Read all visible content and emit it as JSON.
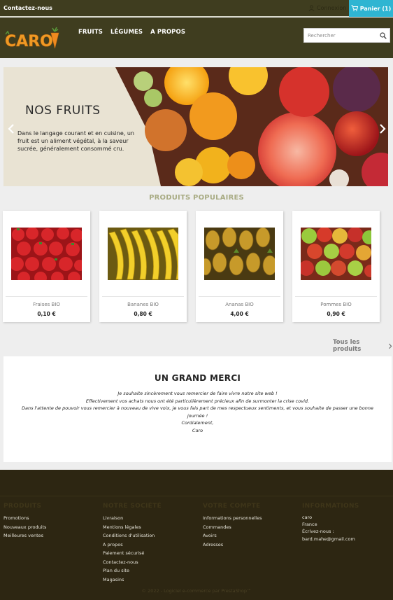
{
  "topbar": {
    "contact_label": "Contactez-nous",
    "login_label": "Connexion",
    "cart_label": "Panier (1)"
  },
  "header": {
    "logo_text": "CARO",
    "nav": [
      "FRUITS",
      "LÉGUMES",
      "A PROPOS"
    ],
    "search_placeholder": "Rechercher"
  },
  "hero": {
    "title": "NOS FRUITS",
    "description": "Dans le langage courant et en cuisine, un fruit est un aliment végétal, à la saveur sucrée, généralement consommé cru."
  },
  "popular": {
    "title": "PRODUITS POPULAIRES",
    "products": [
      {
        "name": "Fraises BIO",
        "price": "0,10 €"
      },
      {
        "name": "Bananes BIO",
        "price": "0,80 €"
      },
      {
        "name": "Ananas BIO",
        "price": "4,00 €"
      },
      {
        "name": "Pommes BIO",
        "price": "0,90 €"
      }
    ],
    "all_products_label": "Tous les produits"
  },
  "thanks": {
    "title": "UN GRAND MERCI",
    "lines": [
      "Je souhaite sincèrement vous remercier de faire vivre notre site web !",
      "Effectivement vos achats nous ont été particulièrement précieux afin de surmonter la crise covid.",
      "Dans l'attente de pouvoir vous remercier à nouveau de vive voix, je vous fais part de mes respectueux sentiments, et vous souhaite de passer une bonne journée !",
      "Cordialement,",
      "Caro"
    ]
  },
  "footer": {
    "columns": [
      {
        "title": "PRODUITS",
        "links": [
          "Promotions",
          "Nouveaux produits",
          "Meilleures ventes"
        ]
      },
      {
        "title": "NOTRE SOCIÉTÉ",
        "links": [
          "Livraison",
          "Mentions légales",
          "Conditions d'utilisation",
          "A propos",
          "Paiement sécurisé",
          "Contactez-nous",
          "Plan du site",
          "Magasins"
        ]
      },
      {
        "title": "VOTRE COMPTE",
        "links": [
          "Informations personnelles",
          "Commandes",
          "Avoirs",
          "Adresses"
        ]
      },
      {
        "title": "INFORMATIONS",
        "lines": [
          "caro",
          "France",
          "Écrivez-nous :",
          "bard.mahe@gmail.com"
        ]
      }
    ],
    "copyright": "© 2022 - Logiciel e-commerce par PrestaShop™"
  },
  "colors": {
    "header_bg": "#3f3d1f",
    "cart_bg": "#2fb5d2",
    "section_title": "#a8ab83",
    "footer_bg": "#2d2612"
  }
}
